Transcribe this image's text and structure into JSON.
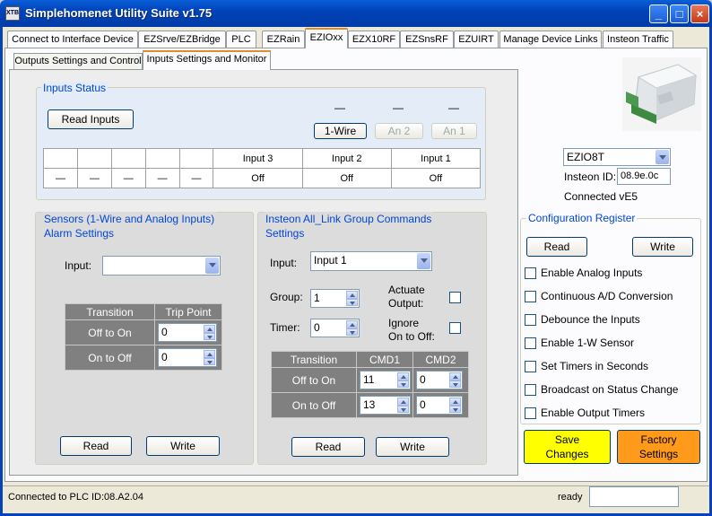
{
  "window": {
    "title": "Simplehomenet Utility Suite v1.75",
    "icon_text": "XTB",
    "min_symbol": "_",
    "max_symbol": "□",
    "close_symbol": "×"
  },
  "tabs": [
    "Connect to Interface Device",
    "EZSrve/EZBridge",
    "PLC",
    "EZRain",
    "EZIOxx",
    "EZX10RF",
    "EZSnsRF",
    "EZUIRT",
    "Manage Device Links",
    "Insteon Traffic"
  ],
  "subtabs": [
    "Outputs Settings and Control",
    "Inputs Settings and Monitor"
  ],
  "inputs_status": {
    "title": "Inputs Status",
    "read_button": "Read Inputs",
    "indicator_values": [
      "—",
      "—",
      "—"
    ],
    "sensor_buttons": [
      "1-Wire",
      "An 2",
      "An 1"
    ],
    "headers": [
      "",
      "",
      "",
      "",
      "",
      "Input 3",
      "Input 2",
      "Input 1"
    ],
    "values": [
      "—",
      "—",
      "—",
      "—",
      "—",
      "Off",
      "Off",
      "Off"
    ]
  },
  "sensors": {
    "title_line1": "Sensors (1-Wire and Analog Inputs)",
    "title_line2": "Alarm Settings",
    "input_label": "Input:",
    "input_value": "",
    "col_transition": "Transition",
    "col_trip": "Trip Point",
    "rows": [
      {
        "label": "Off to On",
        "value": "0"
      },
      {
        "label": "On to Off",
        "value": "0"
      }
    ],
    "read": "Read",
    "write": "Write"
  },
  "alllink": {
    "title_line1": "Insteon All_Link Group Commands",
    "title_line2": "Settings",
    "input_label": "Input:",
    "input_value": "Input 1",
    "group_label": "Group:",
    "group_value": "1",
    "timer_label": "Timer:",
    "timer_value": "0",
    "actuate_line1": "Actuate",
    "actuate_line2": "Output:",
    "ignore_line1": "Ignore",
    "ignore_line2": "On to Off:",
    "col_transition": "Transition",
    "col_cmd1": "CMD1",
    "col_cmd2": "CMD2",
    "rows": [
      {
        "label": "Off to On",
        "cmd1": "11",
        "cmd2": "0"
      },
      {
        "label": "On to Off",
        "cmd1": "13",
        "cmd2": "0"
      }
    ],
    "read": "Read",
    "write": "Write"
  },
  "device": {
    "model": "EZIO8T",
    "insteon_label": "Insteon ID:",
    "insteon_id": "08.9e.0c",
    "connected": "Connected vE5"
  },
  "config": {
    "title": "Configuration Register",
    "read": "Read",
    "write": "Write",
    "options": [
      "Enable Analog Inputs",
      "Continuous A/D Conversion",
      "Debounce the Inputs",
      "Enable 1-W Sensor",
      "Set Timers in Seconds",
      "Broadcast on Status Change",
      "Enable Output Timers"
    ]
  },
  "actions": {
    "save_line1": "Save",
    "save_line2": "Changes",
    "factory_line1": "Factory",
    "factory_line2": "Settings"
  },
  "status": {
    "plc": "Connected to PLC ID:08.A2.04",
    "state": "ready",
    "field_value": ""
  },
  "colors": {
    "titlebar": "#0a5fd8",
    "group_title": "#0046d5",
    "save_bg": "#ffff00",
    "factory_bg": "#ff9a1a",
    "table_dark": "#808080"
  }
}
